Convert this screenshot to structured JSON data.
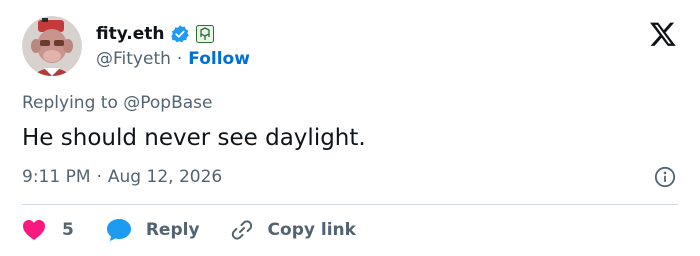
{
  "user": {
    "display_name": "fity.eth",
    "handle": "@Fityeth",
    "separator": "·",
    "follow_label": "Follow",
    "verified_color": "#1d9bf0",
    "avatar_bg": "#c9b9b5"
  },
  "tweet": {
    "replying_prefix": "Replying to",
    "replying_to": "@PopBase",
    "text": "He should never see daylight.",
    "time": "9:11 PM",
    "date": "Aug 12, 2026",
    "separator": "·"
  },
  "actions": {
    "like_count": "5",
    "reply_label": "Reply",
    "copy_label": "Copy link",
    "like_color": "#f91880",
    "reply_color": "#1d9bf0"
  },
  "icons": {
    "brand": "x-logo-icon",
    "info": "info-icon",
    "like": "heart-icon",
    "reply": "speech-bubble-icon",
    "copy": "link-icon"
  }
}
